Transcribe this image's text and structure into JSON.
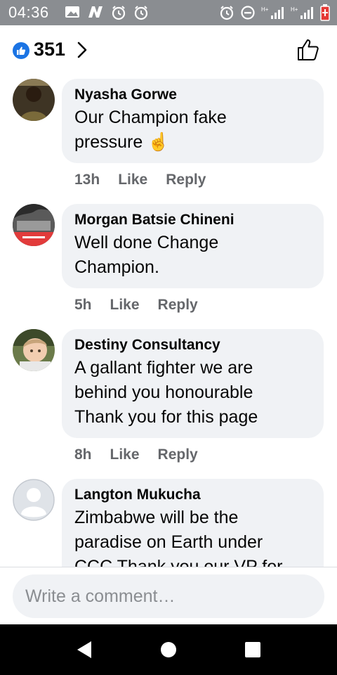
{
  "status_bar": {
    "time": "04:36",
    "icons_left": [
      "image-icon",
      "n-icon",
      "alarm-icon",
      "alarm-icon"
    ],
    "icons_right": [
      "alarm-icon",
      "do-not-disturb-icon",
      "signal-icon",
      "signal-icon",
      "battery-icon"
    ]
  },
  "header": {
    "like_count": "351",
    "colors": {
      "accent": "#1b74e4"
    }
  },
  "comments": [
    {
      "author": "Nyasha Gorwe",
      "lines": [
        "Our Champion fake",
        "pressure ☝"
      ],
      "time": "13h",
      "like": "Like",
      "reply": "Reply"
    },
    {
      "author": "Morgan Batsie Chineni",
      "lines": [
        "Well done Change",
        "Champion."
      ],
      "time": "5h",
      "like": "Like",
      "reply": "Reply"
    },
    {
      "author": "Destiny Consultancy",
      "lines": [
        "A gallant fighter we are",
        "behind you honourable",
        "Thank you for this page"
      ],
      "time": "8h",
      "like": "Like",
      "reply": "Reply"
    },
    {
      "author": "Langton Mukucha",
      "lines": [
        "Zimbabwe will be the",
        "paradise on Earth under",
        "CCC Thank you our VP for"
      ],
      "time": "",
      "like": "",
      "reply": ""
    }
  ],
  "composer": {
    "placeholder": "Write a comment…"
  },
  "nav": [
    "back-icon",
    "home-icon",
    "recents-icon"
  ]
}
